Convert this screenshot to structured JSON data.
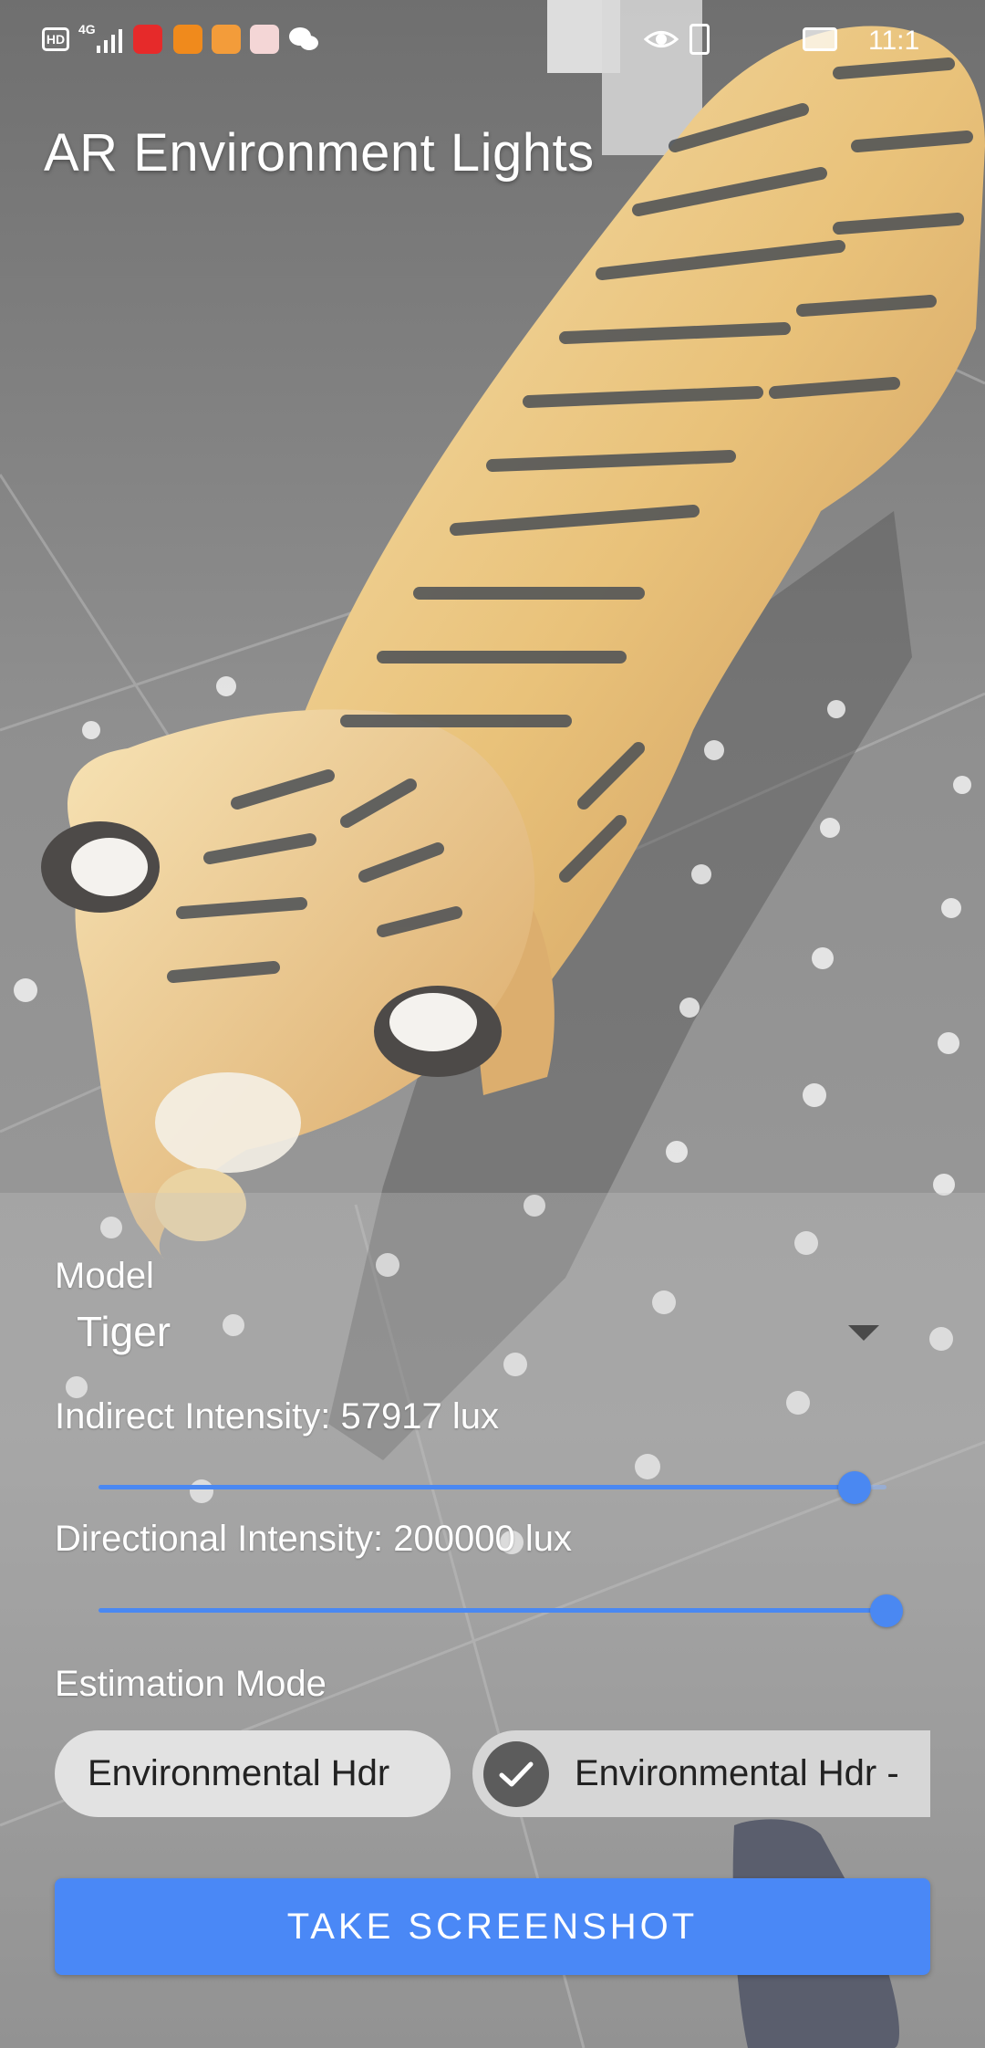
{
  "status_bar": {
    "network": "4G",
    "time": "11:1"
  },
  "app": {
    "title": "AR Environment Lights"
  },
  "controls": {
    "model": {
      "label": "Model",
      "selected": "Tiger"
    },
    "indirect": {
      "label": "Indirect Intensity: 57917 lux",
      "value_fraction": 0.96
    },
    "directional": {
      "label": "Directional Intensity: 200000 lux",
      "value_fraction": 1.0
    },
    "estimation": {
      "label": "Estimation Mode",
      "options": [
        {
          "label": "Environmental Hdr",
          "selected": false
        },
        {
          "label": "Environmental Hdr -",
          "selected": true
        }
      ]
    },
    "take_screenshot": "TAKE SCREENSHOT"
  },
  "colors": {
    "accent": "#4a88f6",
    "chip_bg": "#e2e2e2",
    "check_bg": "#5c5c5c"
  }
}
